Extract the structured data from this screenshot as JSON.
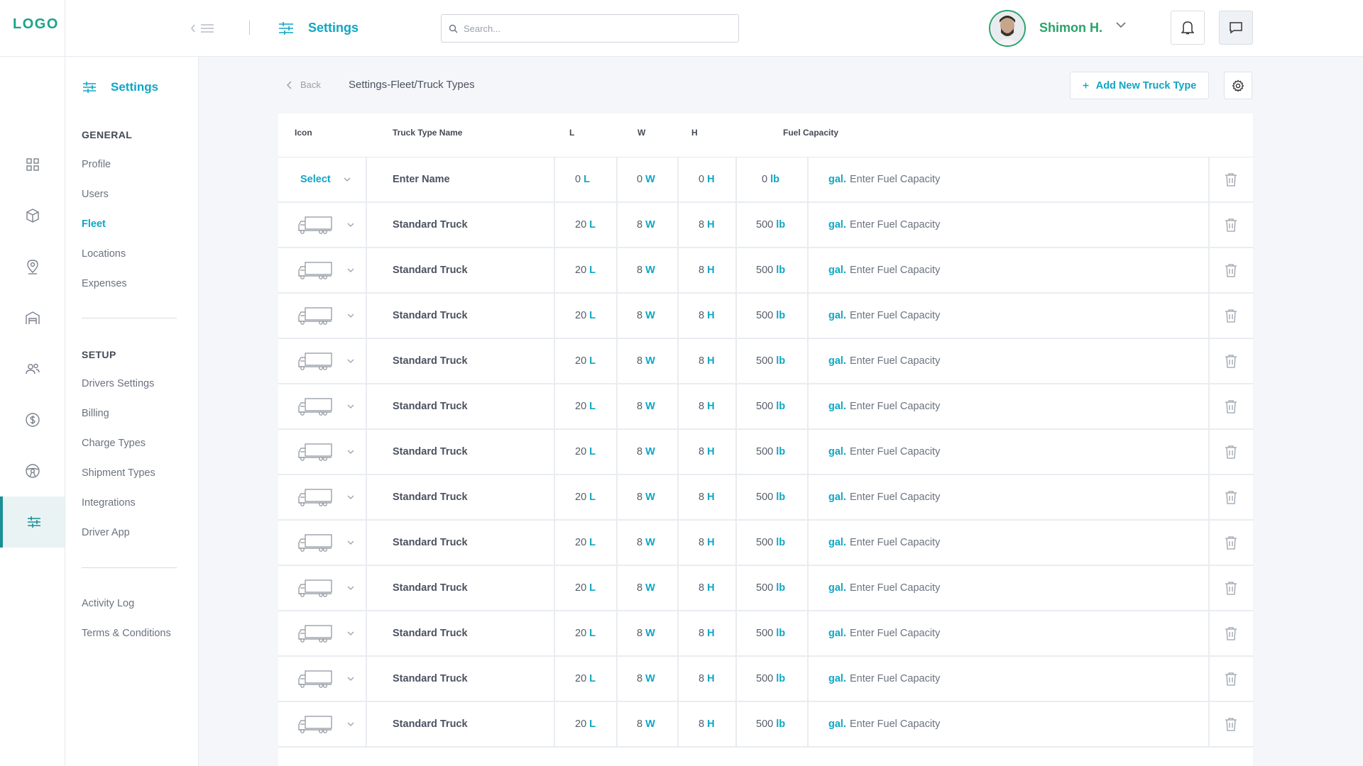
{
  "logo": "LOGO",
  "header": {
    "title": "Settings",
    "search_placeholder": "Search...",
    "user_name": "Shimon H."
  },
  "rail": {
    "items": [
      "dashboard-icon",
      "box-icon",
      "location-pin-icon",
      "warehouse-icon",
      "users-icon",
      "dollar-icon",
      "steering-wheel-icon",
      "sliders-icon"
    ],
    "active": "sliders-icon"
  },
  "subnav": {
    "title": "Settings",
    "general_label": "GENERAL",
    "general_items": [
      "Profile",
      "Users",
      "Fleet",
      "Locations",
      "Expenses"
    ],
    "setup_label": "SETUP",
    "setup_items": [
      "Drivers Settings",
      "Billing",
      "Charge Types",
      "Shipment Types",
      "Integrations",
      "Driver App"
    ],
    "other_items": [
      "Activity Log",
      "Terms & Conditions"
    ],
    "active": "Fleet"
  },
  "breadcrumb": {
    "back": "Back",
    "path_root": "Settings",
    "path_rest": "-Fleet/Truck Types"
  },
  "actions": {
    "add_truck_type": "Add New Truck Type"
  },
  "table": {
    "columns": [
      "Icon",
      "Truck Type Name",
      "L",
      "W",
      "H",
      "Fuel Capacity"
    ],
    "new_row": {
      "icon_select": "Select",
      "name": "Enter Name",
      "l": "0",
      "l_unit": "L",
      "w": "0",
      "w_unit": "W",
      "h": "0",
      "h_unit": "H",
      "weight": "0",
      "weight_unit": "lb",
      "fuel_unit": "gal.",
      "fuel_placeholder": "Enter Fuel Capacity"
    },
    "rows": [
      {
        "name": "Standard Truck",
        "l": "20",
        "w": "8",
        "h": "8",
        "weight": "500"
      },
      {
        "name": "Standard Truck",
        "l": "20",
        "w": "8",
        "h": "8",
        "weight": "500"
      },
      {
        "name": "Standard Truck",
        "l": "20",
        "w": "8",
        "h": "8",
        "weight": "500"
      },
      {
        "name": "Standard Truck",
        "l": "20",
        "w": "8",
        "h": "8",
        "weight": "500"
      },
      {
        "name": "Standard Truck",
        "l": "20",
        "w": "8",
        "h": "8",
        "weight": "500"
      },
      {
        "name": "Standard Truck",
        "l": "20",
        "w": "8",
        "h": "8",
        "weight": "500"
      },
      {
        "name": "Standard Truck",
        "l": "20",
        "w": "8",
        "h": "8",
        "weight": "500"
      },
      {
        "name": "Standard Truck",
        "l": "20",
        "w": "8",
        "h": "8",
        "weight": "500"
      },
      {
        "name": "Standard Truck",
        "l": "20",
        "w": "8",
        "h": "8",
        "weight": "500"
      },
      {
        "name": "Standard Truck",
        "l": "20",
        "w": "8",
        "h": "8",
        "weight": "500"
      },
      {
        "name": "Standard Truck",
        "l": "20",
        "w": "8",
        "h": "8",
        "weight": "500"
      },
      {
        "name": "Standard Truck",
        "l": "20",
        "w": "8",
        "h": "8",
        "weight": "500"
      }
    ],
    "row_units": {
      "l": "L",
      "w": "W",
      "h": "H",
      "weight": "lb",
      "fuel": "gal."
    },
    "row_fuel_placeholder": "Enter Fuel Capacity"
  },
  "colors": {
    "accent": "#0fa6c4",
    "logo": "#1aa38a",
    "user": "#29a36a",
    "rail_active": "#1a8f95"
  }
}
